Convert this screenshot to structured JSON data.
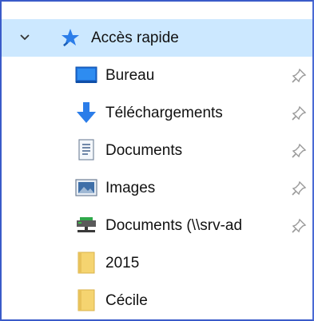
{
  "navigation": {
    "quick_access": {
      "label": "Accès rapide",
      "icon": "star-pin-icon",
      "expanded": true
    },
    "items": [
      {
        "label": "Bureau",
        "icon": "desktop-icon",
        "pinned": true
      },
      {
        "label": "Téléchargements",
        "icon": "download-arrow-icon",
        "pinned": true
      },
      {
        "label": "Documents",
        "icon": "documents-icon",
        "pinned": true
      },
      {
        "label": "Images",
        "icon": "pictures-icon",
        "pinned": true
      },
      {
        "label": "Documents (\\\\srv-ad",
        "icon": "network-drive-icon",
        "pinned": true
      },
      {
        "label": "2015",
        "icon": "folder-icon",
        "pinned": false
      },
      {
        "label": "Cécile",
        "icon": "folder-icon",
        "pinned": false
      }
    ]
  },
  "colors": {
    "selection": "#cce8ff",
    "frame_border": "#3a5bc9",
    "star": "#2b7de9",
    "folder": "#f5d470"
  }
}
